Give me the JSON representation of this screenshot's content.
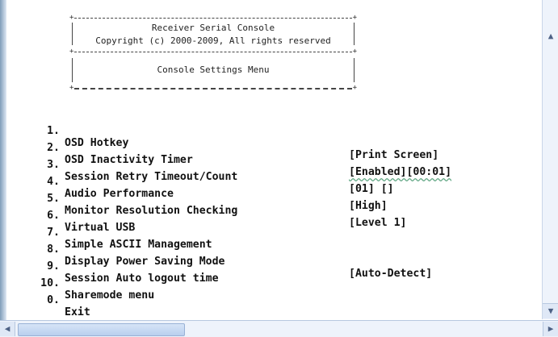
{
  "banner": {
    "title": "Receiver Serial Console",
    "copyright": "Copyright (c) 2000-2009, All rights reserved",
    "menu_title": "Console Settings Menu"
  },
  "menu": [
    {
      "num": "1.",
      "label": "OSD Hotkey",
      "value": "[Print Screen]"
    },
    {
      "num": "2.",
      "label": "OSD Inactivity Timer",
      "value": "[Enabled][00:01]"
    },
    {
      "num": "3.",
      "label": "Session Retry Timeout/Count",
      "value": "[01] []"
    },
    {
      "num": "4.",
      "label": "Audio Performance",
      "value": "[High]"
    },
    {
      "num": "5.",
      "label": "Monitor Resolution Checking",
      "value": "[Level 1]"
    },
    {
      "num": "6.",
      "label": "Virtual USB",
      "value": ""
    },
    {
      "num": "7.",
      "label": "Simple ASCII Management",
      "value": ""
    },
    {
      "num": "8.",
      "label": "Display Power Saving Mode",
      "value": "[Auto-Detect]"
    },
    {
      "num": "9.",
      "label": "Session Auto logout time",
      "value": ""
    },
    {
      "num": "10.",
      "label": "Sharemode menu",
      "value": ""
    },
    {
      "num": "0.",
      "label": "Exit",
      "value": ""
    }
  ],
  "icons": {
    "scroll_up": "chevron-up-icon",
    "scroll_down": "chevron-down-icon",
    "scroll_left": "chevron-left-icon",
    "scroll_right": "chevron-right-icon"
  }
}
